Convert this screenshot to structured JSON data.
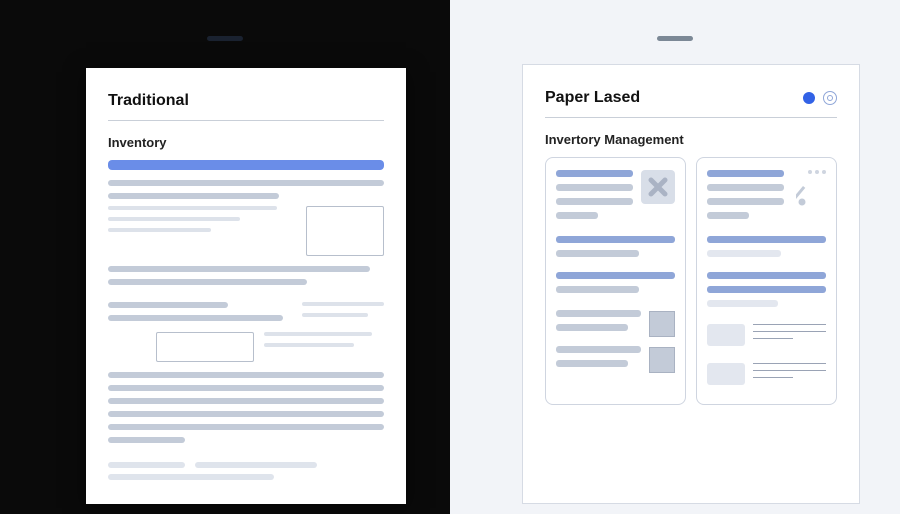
{
  "left": {
    "title": "Traditional",
    "subtitle": "Inventory"
  },
  "right": {
    "title": "Paper Lased",
    "subtitle": "Invertory Management"
  }
}
